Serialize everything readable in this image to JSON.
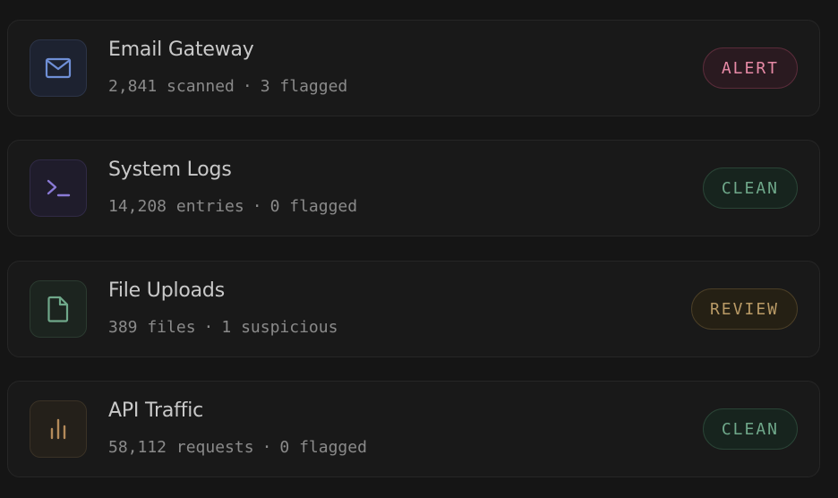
{
  "colors": {
    "email_icon": "#6f8fd6",
    "logs_icon": "#8a7ad6",
    "files_icon": "#6fa88a",
    "api_icon": "#b48a5a",
    "alert": "#e78aa6",
    "clean": "#6fa88a",
    "review": "#b99a66"
  },
  "sources": [
    {
      "icon": "mail-icon",
      "title": "Email Gateway",
      "count": "2,841 scanned",
      "separator": "·",
      "detail": "3 flagged",
      "status": "ALERT"
    },
    {
      "icon": "terminal-icon",
      "title": "System Logs",
      "count": "14,208 entries",
      "separator": "·",
      "detail": "0 flagged",
      "status": "CLEAN"
    },
    {
      "icon": "file-icon",
      "title": "File Uploads",
      "count": "389 files",
      "separator": "·",
      "detail": "1 suspicious",
      "status": "REVIEW"
    },
    {
      "icon": "bar-chart-icon",
      "title": "API Traffic",
      "count": "58,112 requests",
      "separator": "·",
      "detail": "0 flagged",
      "status": "CLEAN"
    }
  ]
}
